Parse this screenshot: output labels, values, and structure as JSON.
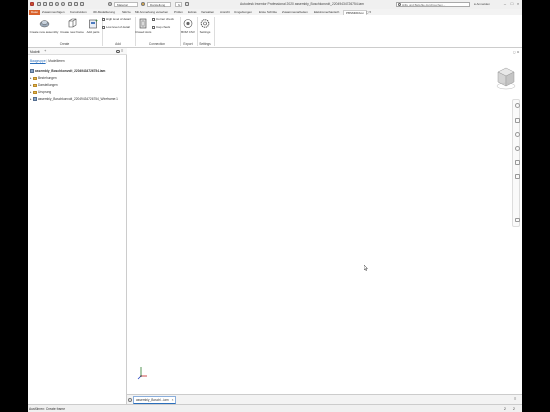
{
  "app": {
    "title": "Autodesk Inventor Professional 2020   assembly_Boschkonvolt_22049434726754.iam",
    "search_placeholder": "Hilfe und Befehle durchsuchen...",
    "sign_in": "Anmelden",
    "quick_access": {
      "material": "Material",
      "appearance": "Darstellung",
      "fx": "fx"
    },
    "window_controls": {
      "minimize": "–",
      "maximize": "□",
      "close": "×"
    }
  },
  "tabs": [
    {
      "label": "Datei"
    },
    {
      "label": "Zusammenfügen"
    },
    {
      "label": "Konstruktion"
    },
    {
      "label": "3D-Modellierung"
    },
    {
      "label": "Skizze"
    },
    {
      "label": "Mit Anmerkung versehen"
    },
    {
      "label": "Prüfen"
    },
    {
      "label": "Extras"
    },
    {
      "label": "Verwalten"
    },
    {
      "label": "Ansicht"
    },
    {
      "label": "Umgebungen"
    },
    {
      "label": "Erste Schritte"
    },
    {
      "label": "Zusammenarbeiten"
    },
    {
      "label": "Elektromechanisch"
    },
    {
      "label": "PBSMRibbon"
    },
    {
      "label": "◻ ▾"
    }
  ],
  "ribbon": {
    "create": {
      "new_assembly": "Create new assembly",
      "new_frame": "Create new frame",
      "add_parts": "Add parts",
      "label": "Create"
    },
    "add": {
      "high_lod": "High level of detail",
      "low_lod": "Low level of detail",
      "label": "Add"
    },
    "connection": {
      "closed_slots": "Closed slots",
      "corner_check": "Corner check",
      "cap_check": "Cap check",
      "label": "Connection"
    },
    "export": {
      "bom_csv": "BOM CSV",
      "label": "Export"
    },
    "settings": {
      "settings": "Settings",
      "label": "Settings"
    }
  },
  "browser": {
    "title": "Modell",
    "close": "×",
    "add": "+",
    "menu": "≡",
    "views": {
      "first": "Baugruppe",
      "separator": "|",
      "second": "Modellieren"
    },
    "items": [
      {
        "label": "assembly_Boschkonvolt_22049434726754.iam"
      },
      {
        "label": "Beziehungen"
      },
      {
        "label": "Darstellungen"
      },
      {
        "label": "Ursprung"
      },
      {
        "label": "assembly_Boschkonvolt_22049434726754_Wireframe:1"
      }
    ]
  },
  "viewport": {
    "corner_a": "◻",
    "corner_b": "⧉"
  },
  "document_tabs": [
    {
      "label": "assembly_Boschl...iam",
      "close": "×"
    }
  ],
  "doctabs_menu": "≡",
  "status": {
    "text": "Ausführen: Create frame",
    "count_a": "2",
    "count_b": "2"
  }
}
